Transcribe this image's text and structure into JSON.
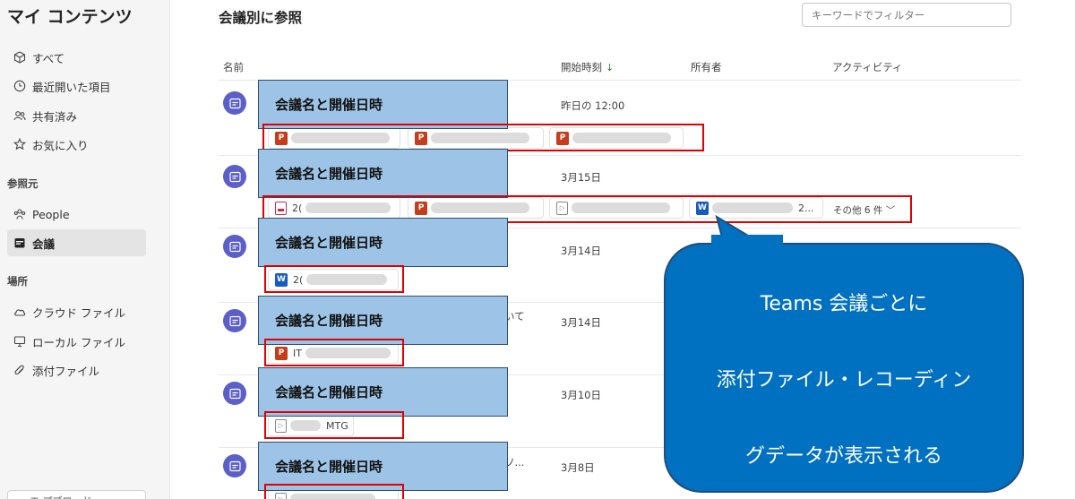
{
  "sidebar": {
    "title": "マイ コンテンツ",
    "items": [
      {
        "label": "すべて",
        "icon": "cube-icon"
      },
      {
        "label": "最近開いた項目",
        "icon": "clock-icon"
      },
      {
        "label": "共有済み",
        "icon": "people-icon"
      },
      {
        "label": "お気に入り",
        "icon": "star-icon"
      }
    ],
    "section_sources": "参照元",
    "sources": [
      {
        "label": "People",
        "icon": "people-group-icon"
      },
      {
        "label": "会議",
        "icon": "calendar-icon",
        "active": true
      }
    ],
    "section_locations": "場所",
    "locations": [
      {
        "label": "クラウド ファイル",
        "icon": "cloud-icon"
      },
      {
        "label": "ローカル ファイル",
        "icon": "monitor-icon"
      },
      {
        "label": "添付ファイル",
        "icon": "paperclip-icon"
      }
    ],
    "bottom_button": "エ プブロード"
  },
  "header": {
    "title": "会議別に参照",
    "filter_placeholder": "キーワードでフィルター"
  },
  "columns": {
    "name": "名前",
    "start_time": "開始時刻",
    "sort_indicator": "↓",
    "owner": "所有者",
    "activity": "アクティビティ"
  },
  "meetings": [
    {
      "title": "会議名と開催日時",
      "time": "昨日の 12:00",
      "files": [
        {
          "type": "powerpoint",
          "text": ""
        },
        {
          "type": "powerpoint",
          "text": ""
        },
        {
          "type": "powerpoint",
          "text": ""
        }
      ]
    },
    {
      "title": "会議名と開催日時",
      "time": "3月15日",
      "files": [
        {
          "type": "pdf",
          "text": "2("
        },
        {
          "type": "powerpoint",
          "text": ""
        },
        {
          "type": "video",
          "text": ""
        },
        {
          "type": "word",
          "text": "2..."
        }
      ],
      "more": "その他 6 件"
    },
    {
      "title": "会議名と開催日時",
      "time": "3月14日",
      "files": [
        {
          "type": "word",
          "text": "2("
        }
      ]
    },
    {
      "title": "会議名と開催日時",
      "subtitle_tail": "いて",
      "time": "3月14日",
      "files": [
        {
          "type": "powerpoint",
          "text": "IT"
        }
      ]
    },
    {
      "title": "会議名と開催日時",
      "time": "3月10日",
      "files": [
        {
          "type": "video",
          "text": "MTG"
        }
      ]
    },
    {
      "title": "会議名と開催日時",
      "subtitle_tail": "ソ...",
      "time": "3月8日",
      "files": []
    }
  ],
  "callout": {
    "line1": "Teams 会議ごとに",
    "line2": "添付ファイル・レコーディン",
    "line3": "グデータが表示される",
    "fill_color": "#0070c0"
  },
  "colors": {
    "annotation_box": "#9dc3e6",
    "highlight_border": "#e00000",
    "meeting_icon": "#5b5fc7"
  }
}
